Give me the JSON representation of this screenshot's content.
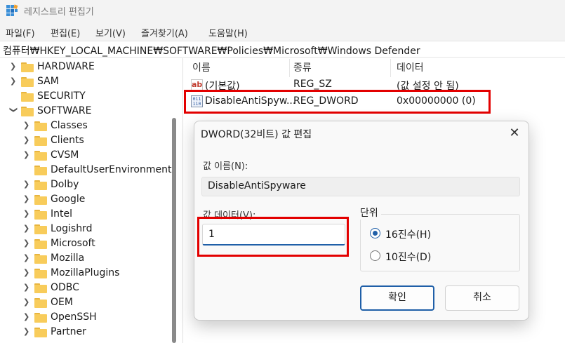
{
  "window": {
    "title": "레지스트리 편집기"
  },
  "menu": [
    "파일(F)",
    "편집(E)",
    "보기(V)",
    "즐겨찾기(A)",
    "도움말(H)"
  ],
  "address": "컴퓨터₩HKEY_LOCAL_MACHINE₩SOFTWARE₩Policies₩Microsoft₩Windows Defender",
  "tree": {
    "items": [
      {
        "label": "HARDWARE"
      },
      {
        "label": "SAM"
      },
      {
        "label": "SECURITY"
      },
      {
        "label": "SOFTWARE"
      },
      {
        "label": "Classes"
      },
      {
        "label": "Clients"
      },
      {
        "label": "CVSM"
      },
      {
        "label": "DefaultUserEnvironment"
      },
      {
        "label": "Dolby"
      },
      {
        "label": "Google"
      },
      {
        "label": "Intel"
      },
      {
        "label": "Logishrd"
      },
      {
        "label": "Microsoft"
      },
      {
        "label": "Mozilla"
      },
      {
        "label": "MozillaPlugins"
      },
      {
        "label": "ODBC"
      },
      {
        "label": "OEM"
      },
      {
        "label": "OpenSSH"
      },
      {
        "label": "Partner"
      }
    ]
  },
  "list": {
    "columns": [
      "이름",
      "종류",
      "데이터"
    ],
    "rows": [
      {
        "name": "(기본값)",
        "type": "REG_SZ",
        "data": "(값 설정 안 됨)",
        "icon": "string-value-icon"
      },
      {
        "name": "DisableAntiSpyw...",
        "type": "REG_DWORD",
        "data": "0x00000000 (0)",
        "icon": "binary-value-icon"
      }
    ]
  },
  "dialog": {
    "title": "DWORD(32비트) 값 편집",
    "close": "✕",
    "name_label": "값 이름(N):",
    "name_value": "DisableAntiSpyware",
    "data_label": "값 데이터(V):",
    "data_value": "1",
    "base_label": "단위",
    "hex_label": "16진수(H)",
    "dec_label": "10진수(D)",
    "selected_base": "hex",
    "ok": "확인",
    "cancel": "취소"
  },
  "colors": {
    "highlight": "#e30000",
    "accent": "#1f5fa8",
    "folder": "#f8cc5b"
  }
}
